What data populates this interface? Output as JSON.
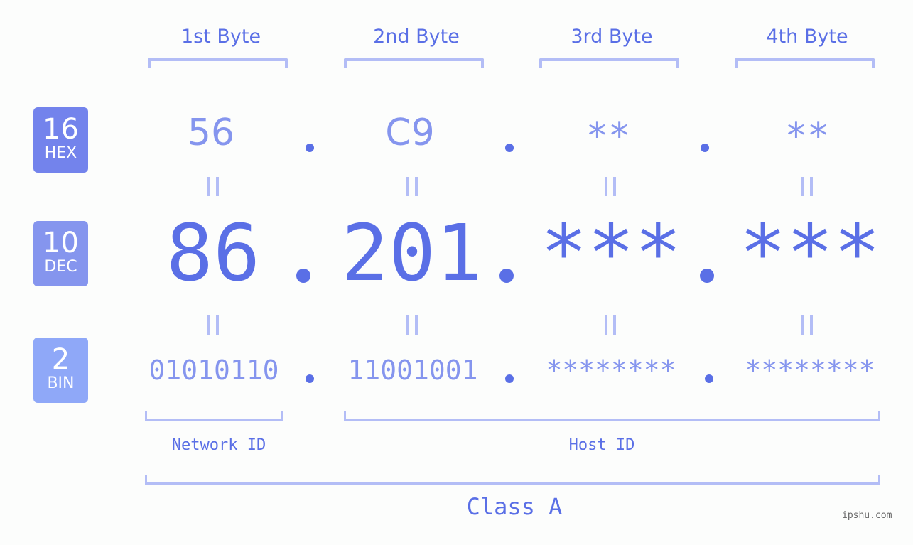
{
  "bytes": {
    "headers": [
      "1st Byte",
      "2nd Byte",
      "3rd Byte",
      "4th Byte"
    ]
  },
  "bases": {
    "hex": {
      "num": "16",
      "label": "HEX",
      "color": "#7383ec"
    },
    "dec": {
      "num": "10",
      "label": "DEC",
      "color": "#8595ee"
    },
    "bin": {
      "num": "2",
      "label": "BIN",
      "color": "#8fa8f8"
    }
  },
  "hex_values": [
    "56",
    "C9",
    "**",
    "**"
  ],
  "dec_values": [
    "86",
    "201",
    "***",
    "***"
  ],
  "bin_values": [
    "01010110",
    "11001001",
    "********",
    "********"
  ],
  "separator": ".",
  "labels": {
    "network_id": "Network ID",
    "host_id": "Host ID",
    "class": "Class A"
  },
  "watermark": "ipshu.com",
  "colors": {
    "accent": "#5a6fe6",
    "light": "#8595ee",
    "bracket": "#b3bdf6"
  }
}
